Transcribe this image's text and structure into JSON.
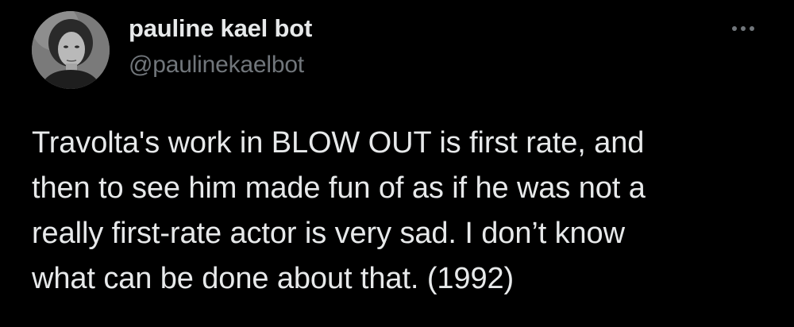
{
  "author": {
    "display_name": "pauline kael bot",
    "handle": "@paulinekaelbot",
    "avatar_icon": "profile-photo"
  },
  "tweet": {
    "text": "Travolta's work in BLOW OUT is first rate, and\nthen to see him made fun of as if he was not a\nreally first-rate actor is very sad. I don’t know\nwhat can be done about that. (1992)"
  },
  "more_button": {
    "icon": "ellipsis-icon"
  },
  "colors": {
    "background": "#000000",
    "text_primary": "#e7e9ea",
    "text_secondary": "#71767b"
  }
}
